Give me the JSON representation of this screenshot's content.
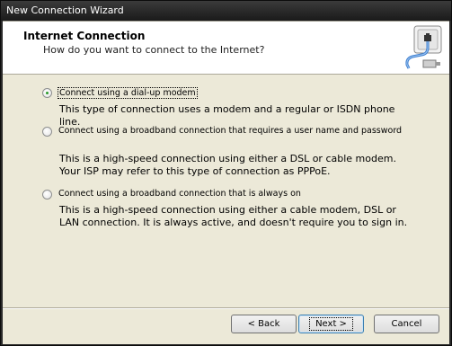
{
  "window": {
    "title": "New Connection Wizard"
  },
  "header": {
    "title": "Internet Connection",
    "subtitle": "How do you want to connect to the Internet?",
    "icon": "network-cable-icon"
  },
  "options": [
    {
      "label": "Connect using a dial-up modem",
      "checked": true,
      "description": "This type of connection uses a modem and a regular or ISDN phone line."
    },
    {
      "label": "Connect using a broadband connection that requires a user name and password",
      "checked": false,
      "description": "This is a high-speed connection using either a DSL or cable modem. Your ISP may refer to this type of connection as PPPoE."
    },
    {
      "label": "Connect using a broadband connection that is always on",
      "checked": false,
      "description": "This is a high-speed connection using either a cable modem, DSL or LAN connection. It is always active, and doesn't require you to sign in."
    }
  ],
  "buttons": {
    "back": "< Back",
    "next": "Next >",
    "cancel": "Cancel"
  }
}
